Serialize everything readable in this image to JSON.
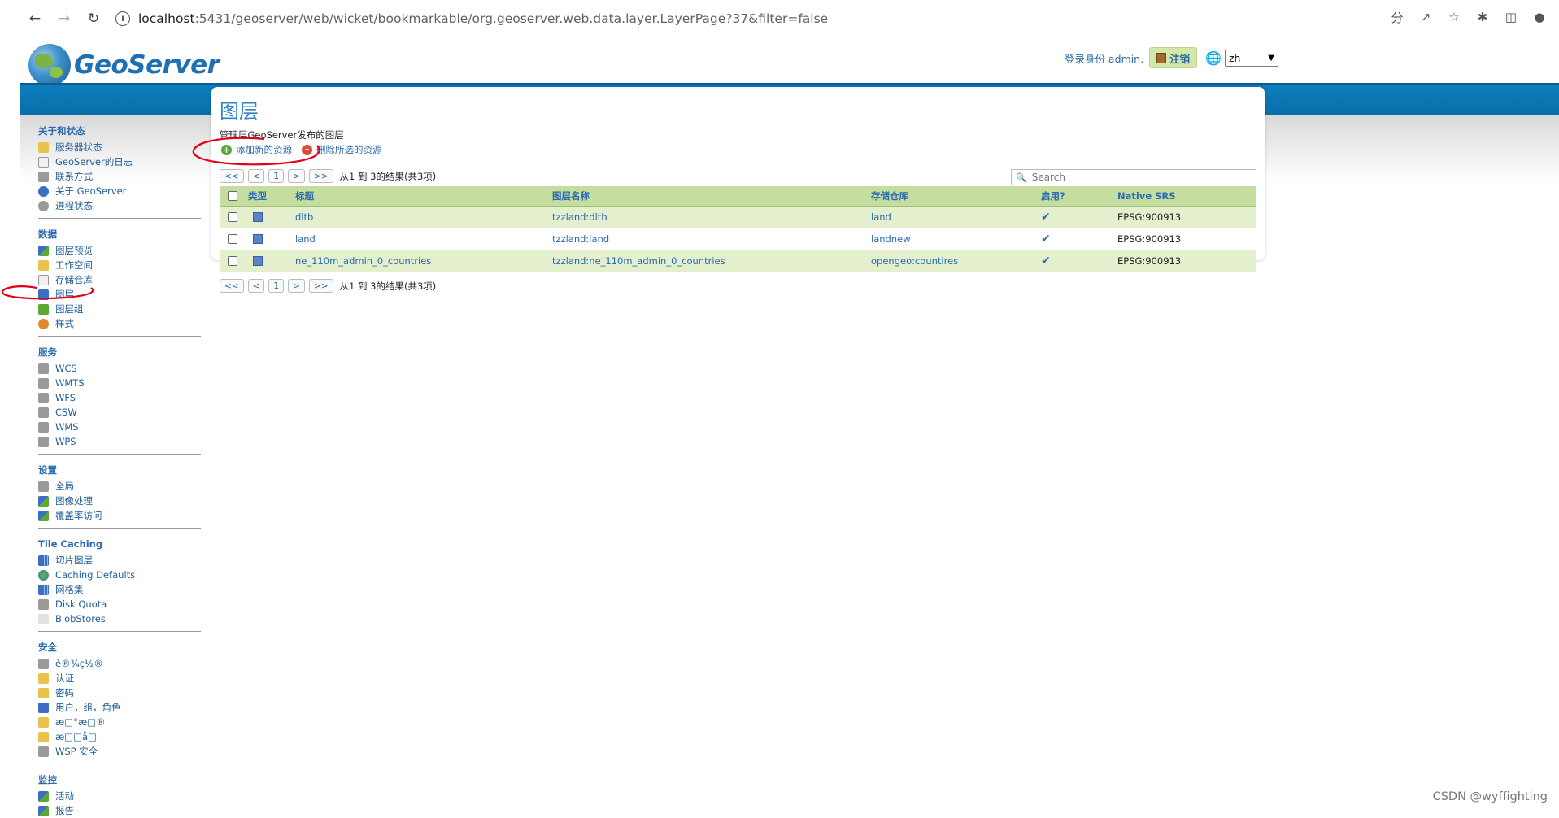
{
  "browser": {
    "url_host": "localhost",
    "url_path": ":5431/geoserver/web/wicket/bookmarkable/org.geoserver.web.data.layer.LayerPage?37&filter=false"
  },
  "header": {
    "logo_text": "GeoServer",
    "login_text": "登录身份 admin.",
    "logout_label": "注销",
    "language_value": "zh"
  },
  "sidebar": {
    "sections": [
      {
        "title": "关于和状态",
        "items": [
          "服务器状态",
          "GeoServer的日志",
          "联系方式",
          "关于 GeoServer",
          "进程状态"
        ]
      },
      {
        "title": "数据",
        "items": [
          "图层预览",
          "工作空间",
          "存储仓库",
          "图层",
          "图层组",
          "样式"
        ]
      },
      {
        "title": "服务",
        "items": [
          "WCS",
          "WMTS",
          "WFS",
          "CSW",
          "WMS",
          "WPS"
        ]
      },
      {
        "title": "设置",
        "items": [
          "全局",
          "图像处理",
          "覆盖率访问"
        ]
      },
      {
        "title": "Tile Caching",
        "items": [
          "切片图层",
          "Caching Defaults",
          "网格集",
          "Disk Quota",
          "BlobStores"
        ]
      },
      {
        "title": "安全",
        "items": [
          "è®¾ç½®",
          "认证",
          "密码",
          "用户，组，角色",
          "æ□°æ□®",
          "æ□□å□i",
          "WSP 安全"
        ]
      },
      {
        "title": "监控",
        "items": [
          "活动",
          "报告"
        ]
      }
    ]
  },
  "main": {
    "title": "图层",
    "description": "管理层GeoServer发布的图层",
    "add_label": "添加新的资源",
    "remove_label": "删除所选的资源",
    "pager": {
      "first": "<<",
      "prev": "<",
      "page": "1",
      "next": ">",
      "last": ">>",
      "summary": "从1 到 3的结果(共3项)"
    },
    "search_placeholder": "Search",
    "columns": [
      "类型",
      "标题",
      "图层名称",
      "存储仓库",
      "启用?",
      "Native SRS"
    ],
    "rows": [
      {
        "title": "dltb",
        "name": "tzzland:dltb",
        "store": "land",
        "enabled": "✔",
        "srs": "EPSG:900913"
      },
      {
        "title": "land",
        "name": "tzzland:land",
        "store": "landnew",
        "enabled": "✔",
        "srs": "EPSG:900913"
      },
      {
        "title": "ne_110m_admin_0_countries",
        "name": "tzzland:ne_110m_admin_0_countries",
        "store": "opengeo:countires",
        "enabled": "✔",
        "srs": "EPSG:900913"
      }
    ]
  },
  "watermark": "CSDN @wyffighting",
  "colors": {
    "accent_blue": "#0c7fbf",
    "row_green": "#e4efcd",
    "header_green": "#c6dda0",
    "annotation_red": "#e0001a"
  }
}
